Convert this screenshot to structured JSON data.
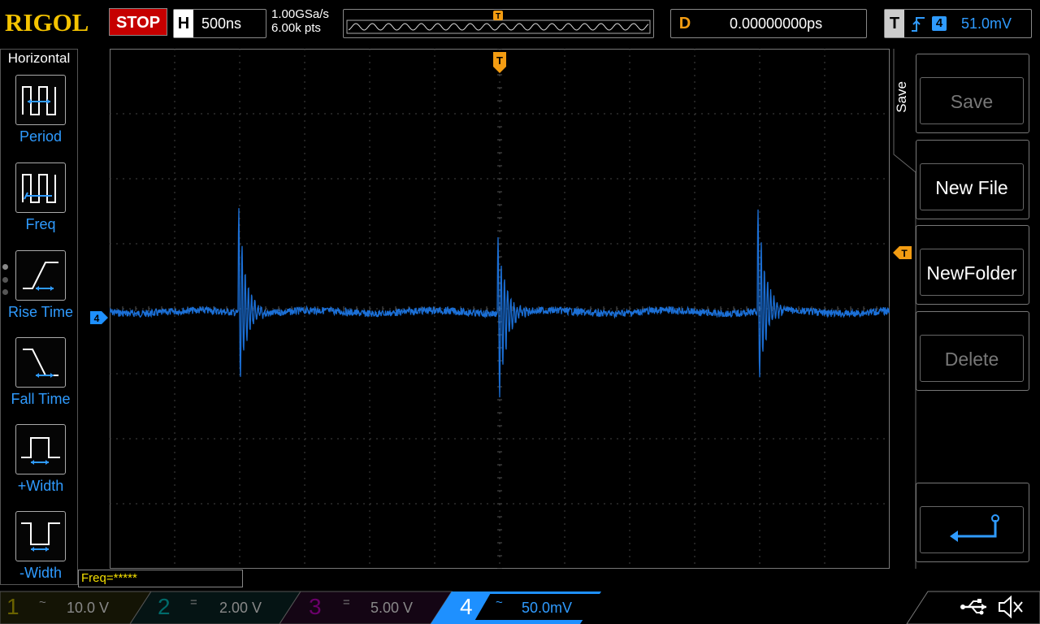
{
  "header": {
    "logo": "RIGOL",
    "run_state": "STOP",
    "timebase_label": "H",
    "timebase": "500ns",
    "sample_rate": "1.00GSa/s",
    "memory_depth": "6.00k pts",
    "delay_label": "D",
    "delay": "0.00000000ps",
    "trigger_label": "T",
    "trigger_source": "4",
    "trigger_level": "51.0mV",
    "trigger_marker": "T"
  },
  "left_menu": {
    "title": "Horizontal",
    "items": [
      {
        "label": "Period",
        "icon": "period-icon"
      },
      {
        "label": "Freq",
        "icon": "frequency-icon"
      },
      {
        "label": "Rise Time",
        "icon": "rise-time-icon"
      },
      {
        "label": "Fall Time",
        "icon": "fall-time-icon"
      },
      {
        "label": "+Width",
        "icon": "positive-width-icon"
      },
      {
        "label": "-Width",
        "icon": "negative-width-icon"
      }
    ]
  },
  "right_menu": {
    "tab": "Save",
    "buttons": [
      {
        "label": "Save",
        "enabled": false
      },
      {
        "label": "New File",
        "enabled": true
      },
      {
        "label": "NewFolder",
        "enabled": true
      },
      {
        "label": "Delete",
        "enabled": false
      }
    ],
    "back_icon": "return-arrow-icon"
  },
  "status": {
    "freq_readout": "Freq=*****"
  },
  "channels": [
    {
      "num": "1",
      "coupling": "~",
      "scale": "10.0 V",
      "active": false,
      "color": "#c8b400"
    },
    {
      "num": "2",
      "coupling": "=",
      "scale": "2.00 V",
      "active": false,
      "color": "#00b4b4"
    },
    {
      "num": "3",
      "coupling": "=",
      "scale": "5.00 V",
      "active": false,
      "color": "#c000c0"
    },
    {
      "num": "4",
      "coupling": "~",
      "scale": "50.0mV",
      "active": true,
      "color": "#1e90ff"
    }
  ],
  "ch4_marker": "4",
  "colors": {
    "trace": "#1b6fd6",
    "trigger": "#f39c12",
    "accent_blue": "#2f9bff",
    "stop": "#c60000",
    "logo": "#f5c400"
  }
}
